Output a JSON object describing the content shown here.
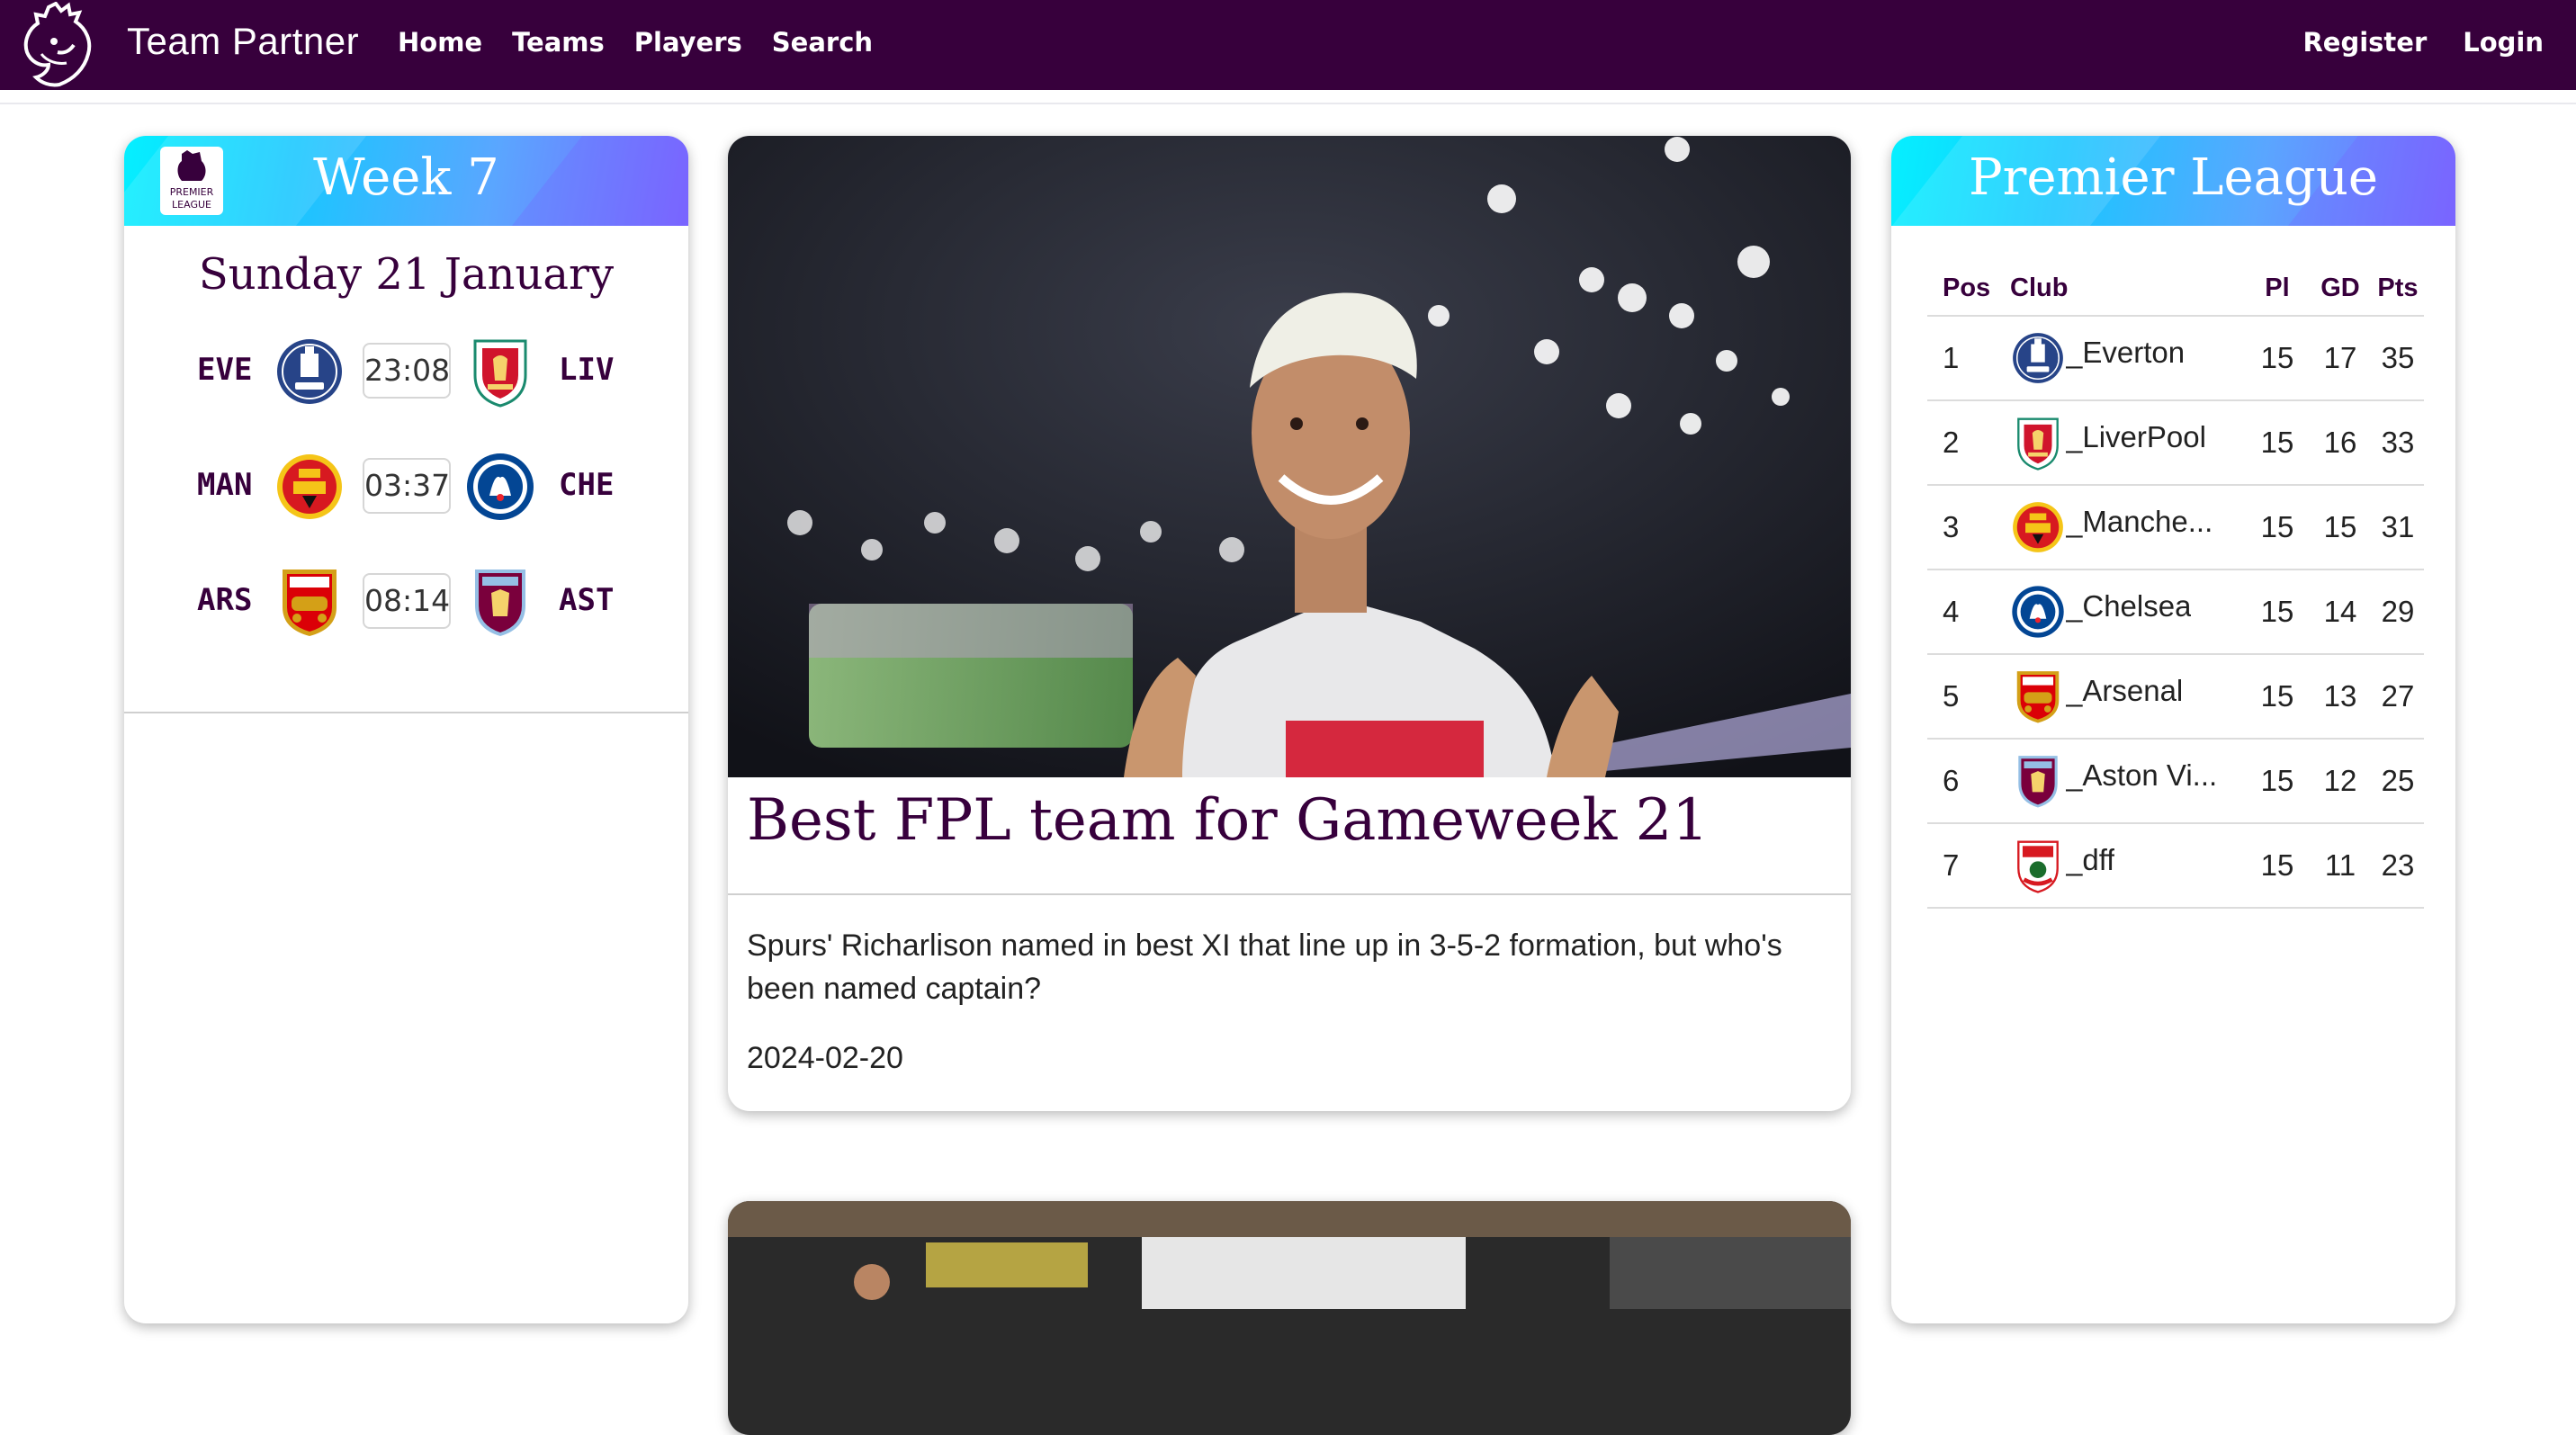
{
  "navbar": {
    "brand": "Team Partner",
    "links": [
      "Home",
      "Teams",
      "Players",
      "Search"
    ],
    "auth": {
      "register": "Register",
      "login": "Login"
    }
  },
  "fixtures_card": {
    "title": "Week 7",
    "date": "Sunday 21 January",
    "fixtures": [
      {
        "home": "EVE",
        "home_crest": "everton-crest-icon",
        "time": "23:08",
        "away": "LIV",
        "away_crest": "liverpool-crest-icon"
      },
      {
        "home": "MAN",
        "home_crest": "man-utd-crest-icon",
        "time": "03:37",
        "away": "CHE",
        "away_crest": "chelsea-crest-icon"
      },
      {
        "home": "ARS",
        "home_crest": "arsenal-crest-icon",
        "time": "08:14",
        "away": "AST",
        "away_crest": "aston-villa-crest-icon"
      }
    ]
  },
  "news": {
    "title": "Best FPL team for Gameweek 21",
    "summary": "Spurs' Richarlison named in best XI that line up in 3-5-2 formation, but who's been named captain?",
    "date": "2024-02-20",
    "image": "player-celebration-photo"
  },
  "standings": {
    "title": "Premier League",
    "headers": {
      "pos": "Pos",
      "club": "Club",
      "pl": "Pl",
      "gd": "GD",
      "pts": "Pts"
    },
    "rows": [
      {
        "pos": "1",
        "club": "Everton",
        "pl": "15",
        "gd": "17",
        "pts": "35",
        "crest": "everton-crest-icon"
      },
      {
        "pos": "2",
        "club": "LiverPool",
        "pl": "15",
        "gd": "16",
        "pts": "33",
        "crest": "liverpool-crest-icon"
      },
      {
        "pos": "3",
        "club": "Manche...",
        "pl": "15",
        "gd": "15",
        "pts": "31",
        "crest": "man-utd-crest-icon"
      },
      {
        "pos": "4",
        "club": "Chelsea",
        "pl": "15",
        "gd": "14",
        "pts": "29",
        "crest": "chelsea-crest-icon"
      },
      {
        "pos": "5",
        "club": "Arsenal",
        "pl": "15",
        "gd": "13",
        "pts": "27",
        "crest": "arsenal-crest-icon"
      },
      {
        "pos": "6",
        "club": "Aston Vi...",
        "pl": "15",
        "gd": "12",
        "pts": "25",
        "crest": "aston-villa-crest-icon"
      },
      {
        "pos": "7",
        "club": "dff",
        "pl": "15",
        "gd": "11",
        "pts": "23",
        "crest": "southampton-crest-icon"
      }
    ]
  },
  "colors": {
    "primary": "#37003c",
    "header_gradient_start": "#05f0ff",
    "header_gradient_end": "#7b67ff"
  }
}
